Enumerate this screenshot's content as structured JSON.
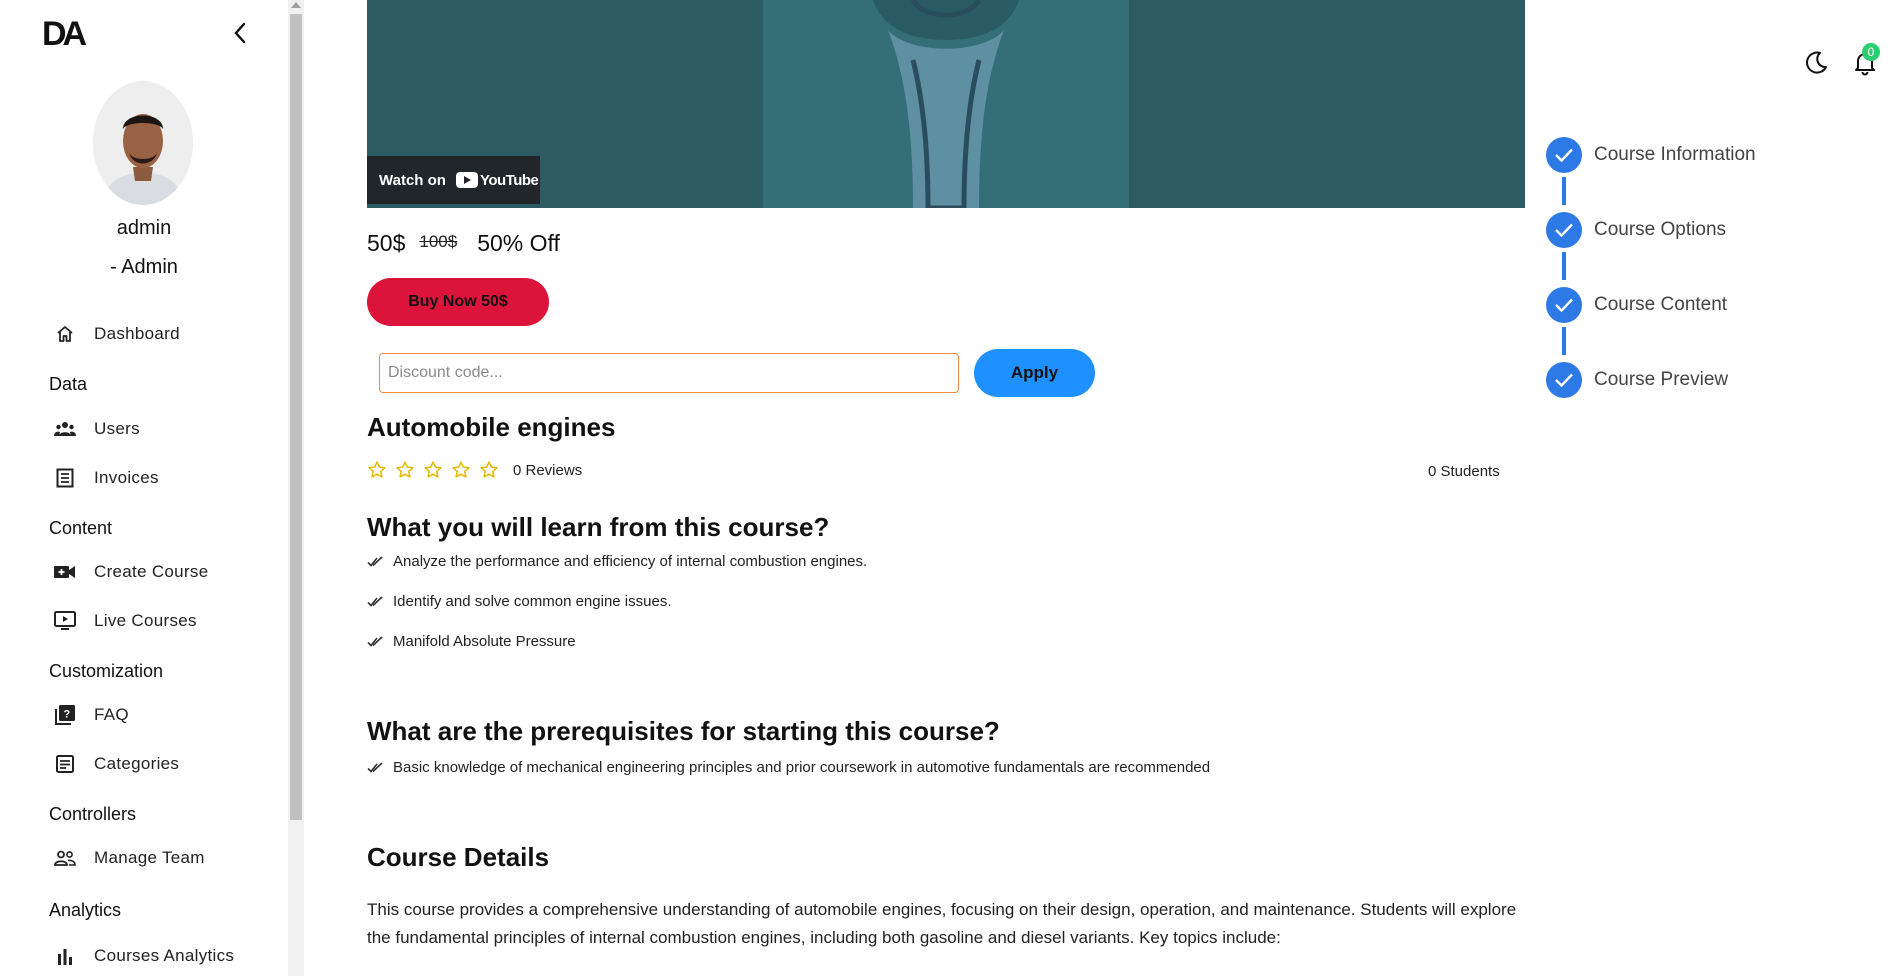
{
  "sidebar": {
    "logo_text": "DA",
    "user": {
      "name": "admin",
      "role": "- Admin"
    },
    "items": [
      {
        "label": "Dashboard"
      },
      {
        "section": "Data"
      },
      {
        "label": "Users"
      },
      {
        "label": "Invoices"
      },
      {
        "section": "Content"
      },
      {
        "label": "Create Course"
      },
      {
        "label": "Live Courses"
      },
      {
        "section": "Customization"
      },
      {
        "label": "FAQ"
      },
      {
        "label": "Categories"
      },
      {
        "section": "Controllers"
      },
      {
        "label": "Manage Team"
      },
      {
        "section": "Analytics"
      },
      {
        "label": "Courses Analytics"
      }
    ]
  },
  "video": {
    "watch_on": "Watch on",
    "platform": "YouTube"
  },
  "pricing": {
    "price": "50$",
    "old_price": "100$",
    "discount": "50% Off",
    "buy_label": "Buy Now 50$"
  },
  "discount": {
    "placeholder": "Discount code...",
    "apply_label": "Apply"
  },
  "course": {
    "title": "Automobile engines",
    "rating_stars": 0,
    "reviews": "0 Reviews",
    "students": "0 Students",
    "learn_heading": "What you will learn from this course?",
    "benefits": [
      "Analyze the performance and efficiency of internal combustion engines.",
      "Identify and solve common engine issues.",
      "Manifold Absolute Pressure"
    ],
    "prereq_heading": "What are the prerequisites for starting this course?",
    "prerequisites": [
      "Basic knowledge of mechanical engineering principles and prior coursework in automotive fundamentals are recommended"
    ],
    "details_heading": "Course Details",
    "details_text": "This course provides a comprehensive understanding of automobile engines, focusing on their design, operation, and maintenance. Students will explore the fundamental principles of internal combustion engines, including both gasoline and diesel variants. Key topics include:"
  },
  "header": {
    "notification_count": "0"
  },
  "steps": [
    {
      "label": "Course Information"
    },
    {
      "label": "Course Options"
    },
    {
      "label": "Course Content"
    },
    {
      "label": "Course Preview"
    }
  ],
  "colors": {
    "buy": "#dc143c",
    "apply": "#1e90ff",
    "step": "#2d7ae6",
    "badge": "#2ecc71",
    "input_border": "#f08a4b"
  }
}
